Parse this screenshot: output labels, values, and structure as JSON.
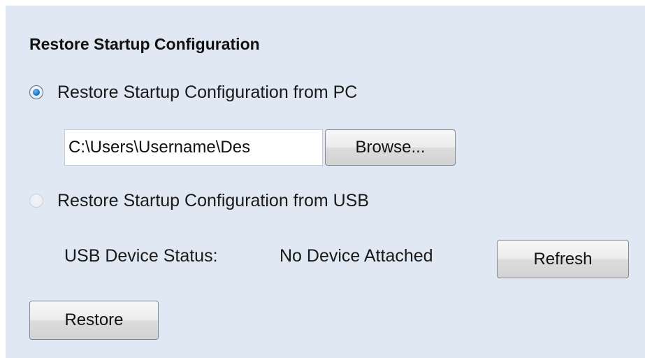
{
  "section": {
    "title": "Restore Startup Configuration"
  },
  "options": {
    "pc": {
      "label": "Restore Startup Configuration from PC",
      "selected": true
    },
    "usb": {
      "label": "Restore Startup Configuration from USB",
      "selected": false,
      "disabled": true
    }
  },
  "file": {
    "path": "C:\\Users\\Username\\Des",
    "browse_label": "Browse..."
  },
  "usb_status": {
    "label": "USB Device Status:",
    "value": "No Device Attached",
    "refresh_label": "Refresh"
  },
  "actions": {
    "restore_label": "Restore"
  }
}
